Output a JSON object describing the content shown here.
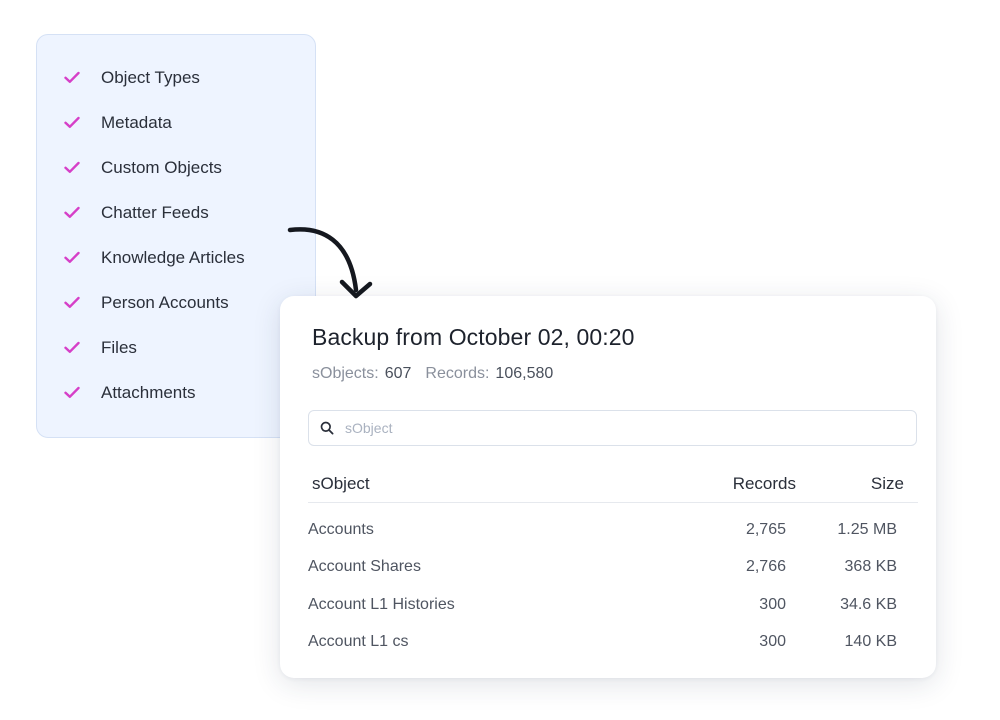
{
  "checklist": {
    "accent_color": "#d63fc8",
    "items": [
      {
        "label": "Object Types",
        "icon": "check-icon"
      },
      {
        "label": "Metadata",
        "icon": "check-icon"
      },
      {
        "label": "Custom Objects",
        "icon": "check-icon"
      },
      {
        "label": "Chatter Feeds",
        "icon": "check-icon"
      },
      {
        "label": "Knowledge Articles",
        "icon": "check-icon"
      },
      {
        "label": "Person Accounts",
        "icon": "check-icon"
      },
      {
        "label": "Files",
        "icon": "check-icon"
      },
      {
        "label": "Attachments",
        "icon": "check-icon"
      }
    ]
  },
  "backup": {
    "title": "Backup from October 02, 00:20",
    "stats": {
      "sobjects_label": "sObjects:",
      "sobjects_value": "607",
      "records_label": "Records:",
      "records_value": "106,580"
    },
    "search": {
      "placeholder": "sObject",
      "value": "",
      "icon": "search-icon"
    },
    "table": {
      "headers": {
        "name": "sObject",
        "records": "Records",
        "size": "Size"
      },
      "rows": [
        {
          "name": "Accounts",
          "records": "2,765",
          "size": "1.25 MB"
        },
        {
          "name": "Account Shares",
          "records": "2,766",
          "size": "368 KB"
        },
        {
          "name": "Account L1 Histories",
          "records": "300",
          "size": "34.6 KB"
        },
        {
          "name": "Account L1 cs",
          "records": "300",
          "size": "140 KB"
        }
      ]
    }
  }
}
